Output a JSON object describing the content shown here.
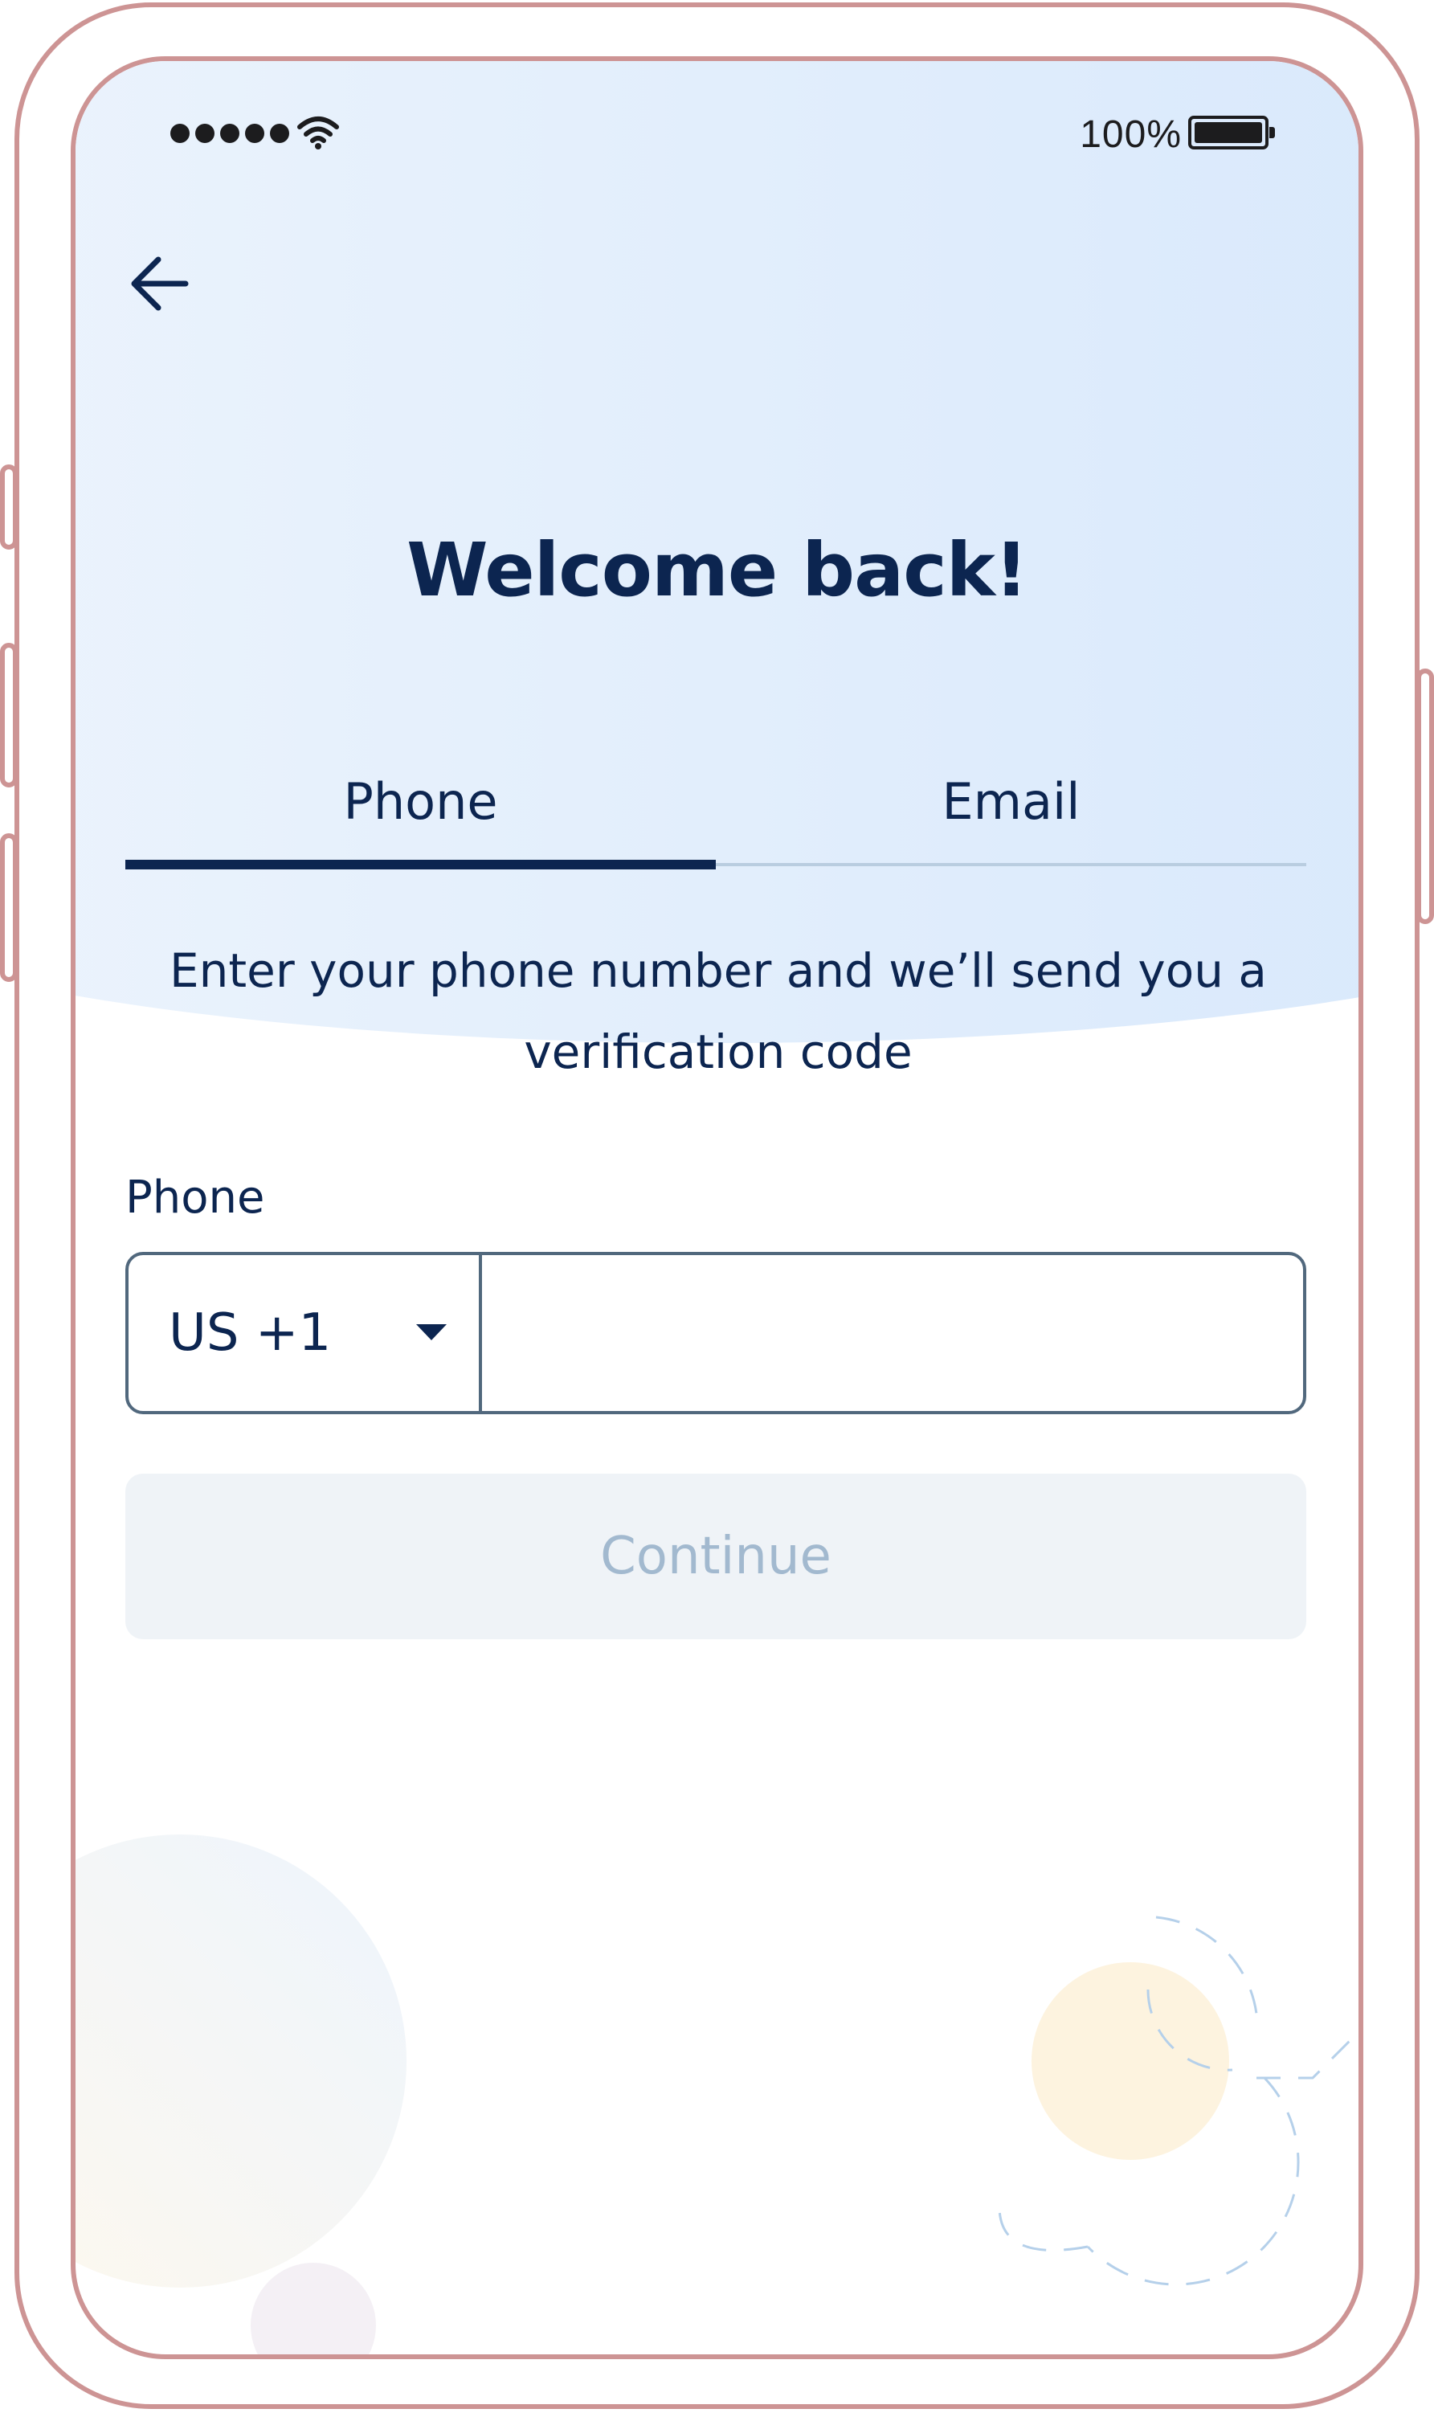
{
  "status_bar": {
    "battery_percent": "100%"
  },
  "header": {
    "title": "Welcome back!"
  },
  "tabs": [
    {
      "label": "Phone",
      "active": true
    },
    {
      "label": "Email",
      "active": false
    }
  ],
  "description": "Enter your phone number and we’ll send you a verification code",
  "form": {
    "phone_label": "Phone",
    "country_code": "US +1",
    "phone_value": "",
    "continue_label": "Continue",
    "continue_enabled": false
  },
  "colors": {
    "primary_text": "#0c2550",
    "disabled_button_bg": "#eff3f7",
    "disabled_button_text": "#a2b9cf",
    "frame": "#cd9494",
    "header_gradient_start": "#eef5fd",
    "header_gradient_end": "#d6e7fb"
  },
  "icons": {
    "back": "arrow-left-icon",
    "wifi": "wifi-icon",
    "battery": "battery-icon",
    "signal": "signal-dots-icon",
    "dropdown": "caret-down-icon"
  }
}
